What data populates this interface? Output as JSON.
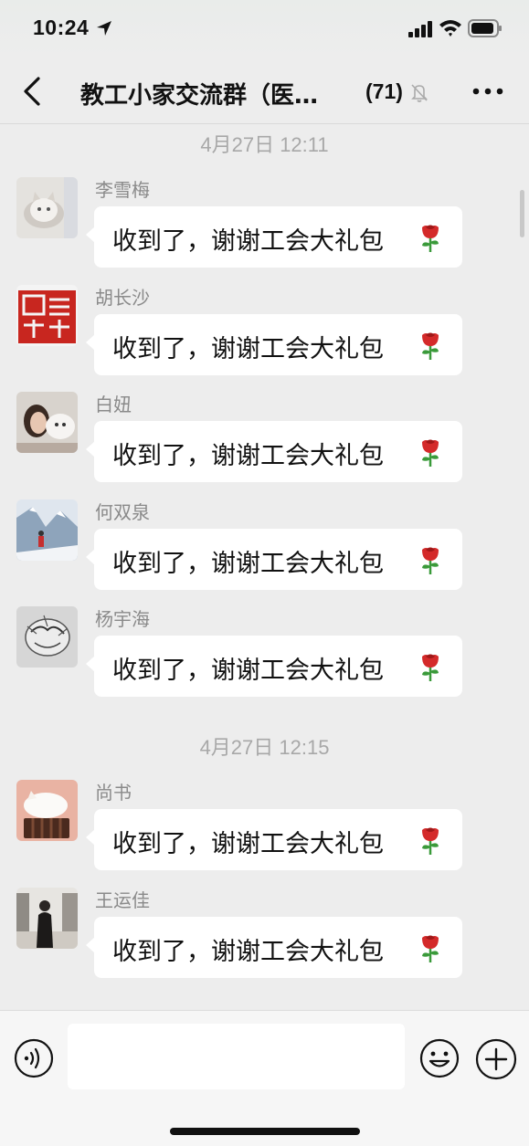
{
  "status_bar": {
    "time": "10:24",
    "icons": [
      "location-arrow-icon",
      "cellular-signal-icon",
      "wifi-icon",
      "battery-icon"
    ]
  },
  "nav": {
    "title": "教工小家交流群（医…",
    "member_count": "(71)",
    "icons": [
      "back-chevron-icon",
      "mute-bell-icon",
      "more-dots-icon"
    ]
  },
  "timestamps": [
    "4月27日 12:11",
    "4月27日 12:15"
  ],
  "messages": [
    {
      "sender": "李雪梅",
      "text": "收到了，谢谢工会大礼包",
      "emoji": "rose-icon",
      "avatar": "cat-photo"
    },
    {
      "sender": "胡长沙",
      "text": "收到了，谢谢工会大礼包",
      "emoji": "rose-icon",
      "avatar": "red-seal"
    },
    {
      "sender": "白妞",
      "text": "收到了，谢谢工会大礼包",
      "emoji": "rose-icon",
      "avatar": "girl-with-dog-photo"
    },
    {
      "sender": "何双泉",
      "text": "收到了，谢谢工会大礼包",
      "emoji": "rose-icon",
      "avatar": "snow-mountain-photo"
    },
    {
      "sender": "杨宇海",
      "text": "收到了，谢谢工会大礼包",
      "emoji": "rose-icon",
      "avatar": "sketch-drawing"
    },
    {
      "sender": "尚书",
      "text": "收到了，谢谢工会大礼包",
      "emoji": "rose-icon",
      "avatar": "white-cat-photo"
    },
    {
      "sender": "王运佳",
      "text": "收到了，谢谢工会大礼包",
      "emoji": "rose-icon",
      "avatar": "person-in-gallery-photo"
    }
  ],
  "input_bar": {
    "value": "",
    "icons": [
      "voice-icon",
      "emoji-face-icon",
      "plus-icon"
    ]
  },
  "colors": {
    "background": "#ededed",
    "bubble": "#ffffff",
    "rose": "#d42a2a"
  }
}
